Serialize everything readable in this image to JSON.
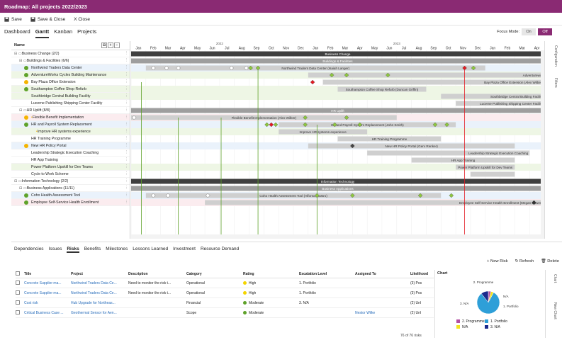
{
  "window": {
    "title": "Roadmap: All projects 2022/2023"
  },
  "toolbar": {
    "save": "Save",
    "save_close": "Save & Close",
    "close": "X  Close"
  },
  "main_tabs": [
    "Dashboard",
    "Gantt",
    "Kanban",
    "Projects"
  ],
  "focus": {
    "label": "Focus Mode:",
    "on": "On",
    "off": "Off"
  },
  "left": {
    "header": "Name"
  },
  "timeline": {
    "years": [
      "2022",
      "2023"
    ],
    "months": [
      "Jan",
      "Feb",
      "Mar",
      "Apr",
      "May",
      "Jun",
      "Jul",
      "Aug",
      "Sep",
      "Oct",
      "Nov",
      "Dec",
      "Jan",
      "Feb",
      "Mar",
      "Apr",
      "May",
      "Jun",
      "Jul",
      "Aug",
      "Sep",
      "Oct",
      "Nov",
      "Dec",
      "Jan",
      "Feb",
      "Mar",
      "Apr"
    ]
  },
  "rows": [
    {
      "name": "Business Change (2/2)",
      "indent": 0,
      "type": "group",
      "bg": "",
      "bar": {
        "label": "Business Change",
        "kind": "dark",
        "start": 0,
        "end": 28
      }
    },
    {
      "name": "Buildings & Facilities (6/6)",
      "indent": 1,
      "type": "group",
      "bg": "",
      "bar": {
        "label": "Buildings & Facilities",
        "kind": "gray",
        "start": 0,
        "end": 28
      }
    },
    {
      "name": "Northwind Traders Data Center",
      "indent": 2,
      "type": "item",
      "dot": "#5fa22a",
      "bg": "blue",
      "bar": {
        "label": "Northwind Traders Data Center (Isaiah Langer)",
        "kind": "light",
        "start": 1,
        "end": 24
      }
    },
    {
      "name": "AdventureWorks Cycles Building Maintenance",
      "indent": 2,
      "type": "item",
      "dot": "#5fa22a",
      "bg": "green",
      "bar": {
        "label": "Adventurewor",
        "kind": "light",
        "start": 12,
        "end": 28
      }
    },
    {
      "name": "Bay Plaza Office Extension",
      "indent": 2,
      "type": "item",
      "dot": "#f4b400",
      "bg": "",
      "bar": {
        "label": "Bay Plaza Office Extension (Alex Wilber)",
        "kind": "light",
        "start": 13,
        "end": 28
      }
    },
    {
      "name": "Southampton Coffee Shop Refurb",
      "indent": 2,
      "type": "item",
      "dot": "#5fa22a",
      "bg": "green",
      "bar": {
        "label": "Southampton Coffee Shop Refurb (Duncan Griffin)",
        "kind": "light",
        "start": 14,
        "end": 20
      }
    },
    {
      "name": "Southbridge Central Building Facility",
      "indent": 2,
      "type": "item",
      "dot": "",
      "bg": "green",
      "bar": {
        "label": "Southbridge Central Building Facility",
        "kind": "light",
        "start": 21,
        "end": 28
      }
    },
    {
      "name": "Lucerne Publishing Shipping Center Facility",
      "indent": 2,
      "type": "item",
      "dot": "",
      "bg": "",
      "bar": {
        "label": "Lucerne Publishing Shipping Center Facility",
        "kind": "light",
        "start": 22,
        "end": 28
      }
    },
    {
      "name": "HR Uplift (8/8)",
      "indent": 1,
      "type": "group",
      "bg": "",
      "bar": {
        "label": "HR Uplift",
        "kind": "gray",
        "start": 0,
        "end": 28
      }
    },
    {
      "name": "Flexible Benefit Implementation",
      "indent": 2,
      "type": "item",
      "dot": "#f4b400",
      "sub": true,
      "bg": "pink",
      "bar": {
        "label": "Flexible Benefit Implementation (Alex Wilber)",
        "kind": "light",
        "start": 0,
        "end": 18
      }
    },
    {
      "name": "HR and Payroll System Replacement",
      "indent": 2,
      "type": "item",
      "dot": "#5fa22a",
      "bg": "blue",
      "bar": {
        "label": "HR and Payroll System Replacement (John Smith)",
        "kind": "light",
        "start": 10,
        "end": 22
      }
    },
    {
      "name": "Improve HR systems experience",
      "indent": 3,
      "type": "item",
      "dot": "",
      "sub": true,
      "bg": "green",
      "bar": {
        "label": "Improve HR systems experience",
        "kind": "light",
        "start": 10,
        "end": 16
      }
    },
    {
      "name": "HR Training Programme",
      "indent": 2,
      "type": "item",
      "dot": "",
      "bg": "",
      "bar": {
        "label": "HR Training Programme",
        "kind": "light",
        "start": 14,
        "end": 21
      }
    },
    {
      "name": "New HR Policy Portal",
      "indent": 2,
      "type": "item",
      "dot": "#f4b400",
      "bg": "blue",
      "bar": {
        "label": "New HR Policy Portal (Gerv Renker)",
        "kind": "light",
        "start": 12,
        "end": 26
      }
    },
    {
      "name": "Leadership Strategic Execution Coaching",
      "indent": 2,
      "type": "item",
      "dot": "",
      "bg": "",
      "bar": {
        "label": "Leadership Strategic Execution Coaching",
        "kind": "light",
        "start": 16,
        "end": 27
      }
    },
    {
      "name": "HR App Training",
      "indent": 2,
      "type": "item",
      "dot": "",
      "bg": "",
      "bar": {
        "label": "HR App Training",
        "kind": "light",
        "start": 19,
        "end": 26
      }
    },
    {
      "name": "Power Platform Upskill for Dev Teams",
      "indent": 2,
      "type": "item",
      "dot": "",
      "bg": "green",
      "bar": {
        "label": "Power Platform Upskill for Dev Teams",
        "kind": "light",
        "start": 22,
        "end": 26
      }
    },
    {
      "name": "Cycle to Work Scheme",
      "indent": 2,
      "type": "item",
      "dot": "",
      "bg": "",
      "bar": {
        "label": "",
        "kind": "light",
        "start": 23,
        "end": 26
      }
    },
    {
      "name": "Information Technology (2/2)",
      "indent": 0,
      "type": "group",
      "bg": "",
      "bar": {
        "label": "Information Technology",
        "kind": "dark",
        "start": 0,
        "end": 28
      }
    },
    {
      "name": "Business Applications (11/11)",
      "indent": 1,
      "type": "group",
      "bg": "",
      "bar": {
        "label": "Business Applications",
        "kind": "gray",
        "start": 0,
        "end": 28
      }
    },
    {
      "name": "Coho Health Assessment Tool",
      "indent": 2,
      "type": "item",
      "dot": "#5fa22a",
      "bg": "blue",
      "bar": {
        "label": "Coho Health Assessment Tool (Alfonso Castro)",
        "kind": "light",
        "start": 1,
        "end": 21
      }
    },
    {
      "name": "Employee Self-Service Health Enrollment",
      "indent": 2,
      "type": "item",
      "dot": "#5fa22a",
      "bg": "pink",
      "bar": {
        "label": "Employee Self-Service Health Enrollment (Megan Bowen)",
        "kind": "light",
        "start": 5,
        "end": 28
      }
    }
  ],
  "markers": [
    {
      "row": 2,
      "m": [
        1.5,
        2.4,
        3.2,
        6.8,
        7.8
      ],
      "shape": "diamond",
      "color": "#fff"
    },
    {
      "row": 2,
      "m": [
        8.1,
        8.6
      ],
      "shape": "diamond",
      "color": "#8dc63f"
    },
    {
      "row": 2,
      "m": [
        22.6
      ],
      "shape": "diamond",
      "color": "#e31b23"
    },
    {
      "row": 2,
      "m": [
        23.2
      ],
      "shape": "diamond",
      "color": "#8dc63f"
    },
    {
      "row": 3,
      "m": [
        13.6,
        14.6,
        17.4
      ],
      "shape": "diamond",
      "color": "#8dc63f"
    },
    {
      "row": 4,
      "m": [
        12.3
      ],
      "shape": "diamond",
      "color": "#e31b23"
    },
    {
      "row": 10,
      "m": [
        9.2,
        9.8,
        11.8,
        13.8,
        15.5,
        20.6,
        21.4
      ],
      "shape": "diamond",
      "color": "#8dc63f"
    },
    {
      "row": 10,
      "m": [
        9.5
      ],
      "shape": "diamond",
      "color": "#e31b23"
    },
    {
      "row": 9,
      "m": [
        0.2
      ],
      "shape": "diamond",
      "color": "#fff"
    },
    {
      "row": 9,
      "m": [
        11.8,
        14.6
      ],
      "shape": "diamond",
      "color": "#8dc63f"
    },
    {
      "row": 13,
      "m": [
        15
      ],
      "shape": "diamond",
      "color": "#444"
    },
    {
      "row": 20,
      "m": [
        1.5,
        2.5,
        5.2
      ],
      "shape": "diamond",
      "color": "#fff"
    },
    {
      "row": 20,
      "m": [
        12.6,
        15,
        19.6,
        21.7
      ],
      "shape": "diamond",
      "color": "#8dc63f"
    },
    {
      "row": 21,
      "m": [
        27.3
      ],
      "shape": "diamond",
      "color": "#333"
    }
  ],
  "bottom_tabs": [
    "Dependencies",
    "Issues",
    "Risks",
    "Benefits",
    "Milestones",
    "Lessons Learned",
    "Investment",
    "Resource Demand"
  ],
  "bottom_actions": {
    "new": "+  New Risk",
    "refresh": "↻  Refresh",
    "delete": "🗑  Delete"
  },
  "risk_table": {
    "headers": [
      "Title",
      "Project",
      "Description",
      "Category",
      "Rating",
      "Escalation Level",
      "Assigned To",
      "Likelihood"
    ],
    "rows": [
      {
        "title": "Concrete Supplier ma...",
        "project": "Northwind Traders Data Ce...",
        "desc": "Need to monitor the risk t...",
        "cat": "Operational",
        "rating": "High",
        "rcolor": "#f4d400",
        "esc": "1. Portfolio",
        "assigned": "",
        "like": "(3) Pos"
      },
      {
        "title": "Concrete Supplier ma...",
        "project": "Northwind Traders Data Ce...",
        "desc": "Need to monitor the risk t...",
        "cat": "Operational",
        "rating": "High",
        "rcolor": "#f4d400",
        "esc": "1. Portfolio",
        "assigned": "",
        "like": "(3) Pos"
      },
      {
        "title": "Cost risk",
        "project": "Hub Upgrade for Northeas...",
        "desc": "",
        "cat": "Financial",
        "rating": "Moderate",
        "rcolor": "#5fa22a",
        "esc": "3. N/A",
        "assigned": "",
        "like": "(2) Unl"
      },
      {
        "title": "Critical Business Case ...",
        "project": "Geothermal Sensor for Aen...",
        "desc": "",
        "cat": "Scope",
        "rating": "Moderate",
        "rcolor": "#5fa22a",
        "esc": "",
        "assigned": "Nestor Wilke",
        "like": "(2) Unl"
      }
    ],
    "count": "76 of 76 risks"
  },
  "risk_chart": {
    "title": "Chart",
    "slices": [
      {
        "label": "2. Programme",
        "value": 3,
        "color": "#b34fa4"
      },
      {
        "label": "N/A",
        "value": 3,
        "color": "#f4e41f"
      },
      {
        "label": "1. Portfolio",
        "value": 62,
        "color": "#2e9fd8"
      },
      {
        "label": "3. N/A",
        "value": 8,
        "color": "#1b2a8c"
      }
    ],
    "callouts": [
      "2. Programme",
      "N/A",
      "1. Portfolio",
      "3. N/A"
    ],
    "legend": [
      "2. Programme",
      "1. Portfolio",
      "N/A",
      "3. N/A"
    ]
  },
  "rail": {
    "a": "Configuration",
    "b": "Filters",
    "c": "Chart",
    "d": "New Chart"
  }
}
